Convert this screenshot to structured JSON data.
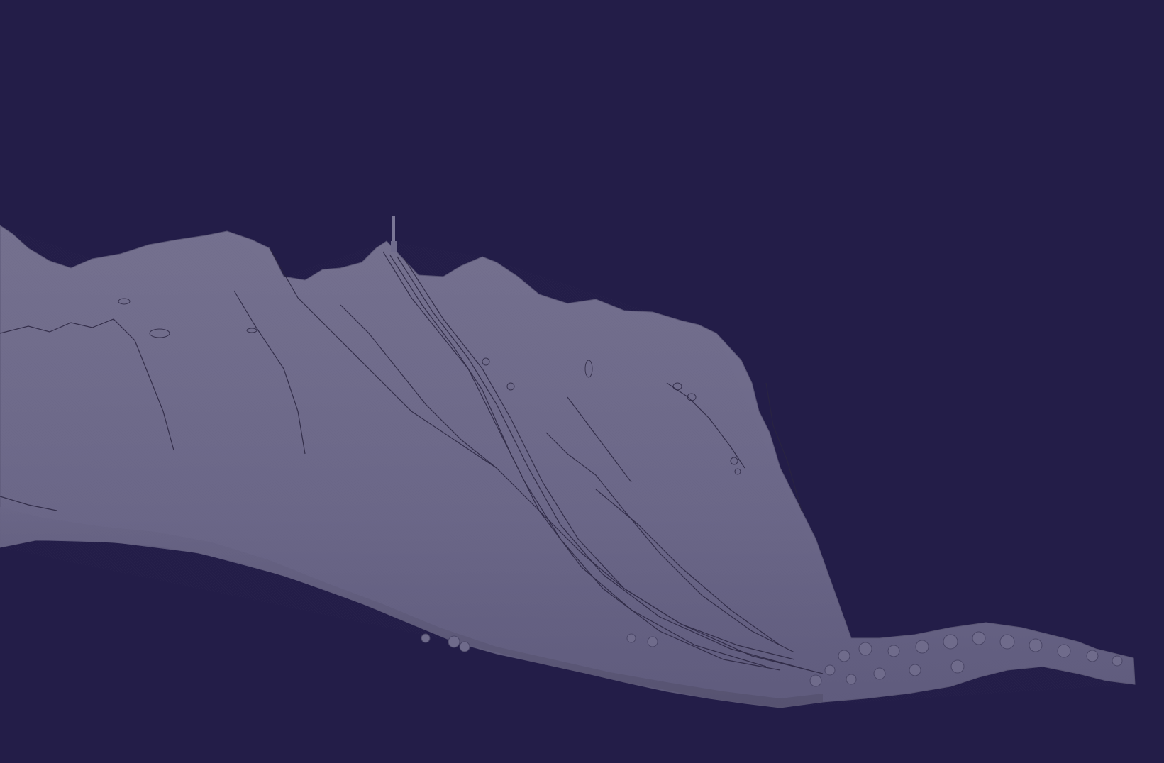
{
  "scene": {
    "background_color": "#231d48",
    "terrain_color": "#6c6889",
    "terrain_shadow_color": "#4a4666",
    "contour_color": "#2a2540"
  }
}
